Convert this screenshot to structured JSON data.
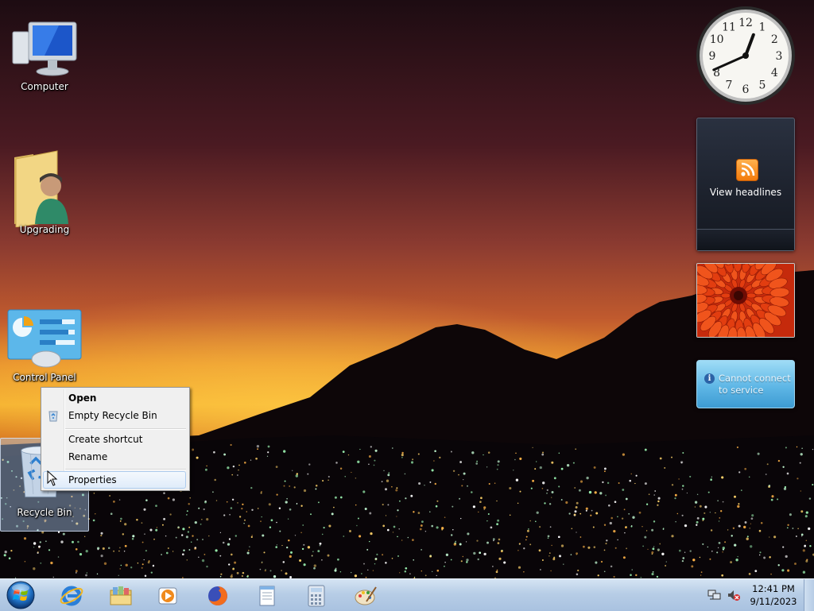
{
  "desktop": {
    "icons": [
      {
        "name": "computer",
        "label": "Computer"
      },
      {
        "name": "upgrading-folder",
        "label": "Upgrading"
      },
      {
        "name": "control-panel",
        "label": "Control Panel"
      },
      {
        "name": "recycle-bin",
        "label": "Recycle Bin"
      }
    ]
  },
  "gadgets": {
    "clock": {
      "hour": 12,
      "minute": 41,
      "numerals": [
        "12",
        "1",
        "2",
        "3",
        "4",
        "5",
        "6",
        "7",
        "8",
        "9",
        "10",
        "11"
      ]
    },
    "feed": {
      "label": "View headlines",
      "icon": "rss-icon"
    },
    "slideshow": {
      "subject": "red dahlia flower"
    },
    "weather": {
      "message": "Cannot connect to service",
      "icon": "info-icon"
    }
  },
  "context_menu": {
    "items": [
      {
        "label": "Open",
        "bold": true
      },
      {
        "label": "Empty Recycle Bin",
        "icon": "recycle-bin-icon"
      },
      {
        "label": "Create shortcut"
      },
      {
        "label": "Rename"
      },
      {
        "label": "Properties",
        "highlighted": true
      }
    ]
  },
  "taskbar": {
    "start": {
      "icon": "windows-logo-icon"
    },
    "pinned": [
      {
        "name": "internet-explorer",
        "icon": "internet-explorer-icon"
      },
      {
        "name": "windows-explorer",
        "icon": "folder-library-icon"
      },
      {
        "name": "media-player",
        "icon": "media-player-icon"
      },
      {
        "name": "firefox",
        "icon": "firefox-icon"
      },
      {
        "name": "notepad",
        "icon": "notepad-icon"
      },
      {
        "name": "calculator",
        "icon": "calculator-icon"
      },
      {
        "name": "paint",
        "icon": "paint-palette-icon"
      }
    ],
    "tray": {
      "time": "12:41 PM",
      "date": "9/11/2023",
      "icons": [
        "network-icon",
        "speaker-muted-icon"
      ]
    }
  },
  "colors": {
    "taskbar_top": "#d5e4f3",
    "taskbar_bottom": "#a9c2e0",
    "menu_bg": "#f0f0f0",
    "menu_highlight": "#e0ecfa",
    "weather_bg": "#5fb7e6"
  }
}
